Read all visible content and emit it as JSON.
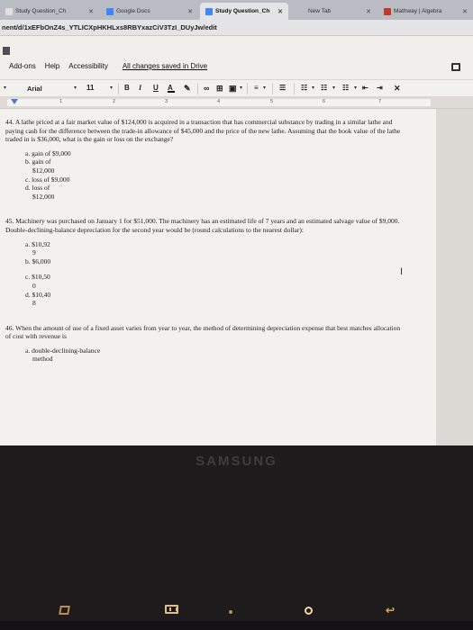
{
  "browser": {
    "tabs": [
      {
        "title": "Study Question_Ch",
        "icon_color": "#e0e0e0"
      },
      {
        "title": "Google Docs",
        "icon_color": "#4285f4"
      },
      {
        "title": "Study Question_Ch",
        "icon_color": "#4285f4"
      },
      {
        "title": "New Tab",
        "icon_color": "#bbbbbb"
      },
      {
        "title": "Mathway | Algebra",
        "icon_color": "#c0392b"
      }
    ],
    "url": "nent/d/1xEFbOnZ4s_YTLICXpHKHLxs8RBYxazCiV3TzI_DUyJw/edit"
  },
  "docs": {
    "menu": [
      "Add-ons",
      "Help",
      "Accessibility"
    ],
    "save_status": "All changes saved in Drive",
    "toolbar": {
      "font": "Arial",
      "font_size": "11",
      "bold": "B",
      "italic": "I",
      "underline": "U",
      "text_color": "A"
    },
    "ruler_numbers": [
      "1",
      "2",
      "3",
      "4",
      "5",
      "6",
      "7"
    ]
  },
  "document": {
    "q44": {
      "text": "44. A lathe priced at a fair market value of $124,000 is acquired in a transaction that has commercial substance by trading in a similar lathe and paying cash for the difference between the trade-in allowance of $45,000 and the price of the new lathe. Assuming that the book value of the lathe traded in is $36,000, what is the gain or loss on the exchange?",
      "a": "a. gain of $9,000",
      "b1": "b. gain of",
      "b2": "$12,000",
      "c": "c. loss of $9,000",
      "d1": "d. loss of",
      "d2": "$12,000"
    },
    "q45": {
      "text": "45. Machinery was purchased on January 1 for $51,000. The machinery has an estimated life of 7 years and an estimated salvage value of $9,000. Double-declining-balance depreciation for the second year would be (round calculations to the nearest dollar):",
      "a1": "a. $10,92",
      "a2": "9",
      "b": "b. $6,000",
      "c1": "c. $10,50",
      "c2": "0",
      "d1": "d. $10,40",
      "d2": "8"
    },
    "q46": {
      "text": "46. When the amount of use of a fixed asset varies from year to year, the method of determining depreciation expense that best matches allocation of cost with revenue is",
      "a1": "a. double-declining-balance",
      "a2": "method"
    }
  },
  "device": {
    "brand": "SAMSUNG"
  }
}
